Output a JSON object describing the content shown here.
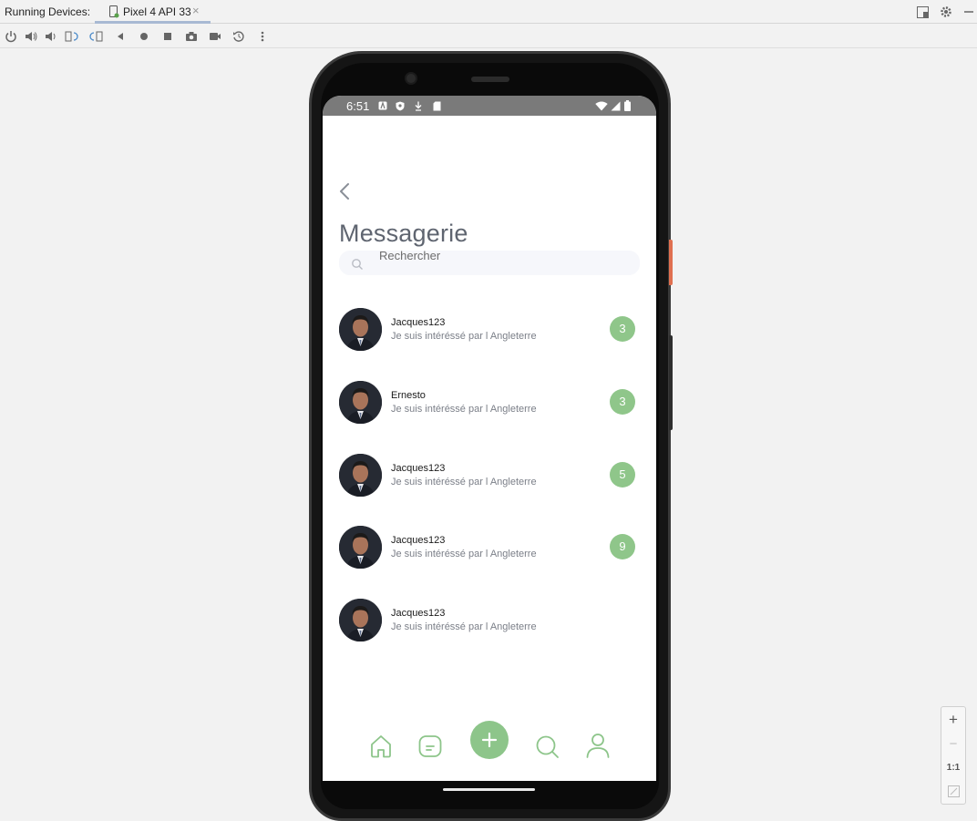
{
  "ide": {
    "panel_title": "Running Devices:",
    "device_tab": "Pixel 4 API 33",
    "tab_close": "×",
    "toolbar_icons": [
      "power-icon",
      "volume-up-icon",
      "volume-down-icon",
      "rotate-left-icon",
      "rotate-right-icon",
      "back-icon",
      "home-icon",
      "overview-icon",
      "screenshot-icon",
      "screen-record-icon",
      "reset-icon",
      "more-icon"
    ],
    "zoom": {
      "plus": "+",
      "minus": "−",
      "actual_size": "1:1"
    }
  },
  "status_bar": {
    "time": "6:51"
  },
  "app": {
    "title": "Messagerie",
    "search_placeholder": "Rechercher",
    "conversations": [
      {
        "name": "Jacques123",
        "message": "Je suis intéréssé par l Angleterre",
        "unread": "3"
      },
      {
        "name": "Ernesto",
        "message": "Je suis intéréssé par l Angleterre",
        "unread": "3"
      },
      {
        "name": "Jacques123",
        "message": "Je suis intéréssé par l Angleterre",
        "unread": "5"
      },
      {
        "name": "Jacques123",
        "message": "Je suis intéréssé par l Angleterre",
        "unread": "9"
      },
      {
        "name": "Jacques123",
        "message": "Je suis intéréssé par l Angleterre",
        "unread": ""
      }
    ],
    "nav": [
      "home-icon",
      "messages-icon",
      "add-icon",
      "search-icon",
      "profile-icon"
    ]
  },
  "colors": {
    "accent_green": "#8dc58a",
    "title_grey": "#5f6570",
    "status_bar": "#7a7a7a"
  }
}
